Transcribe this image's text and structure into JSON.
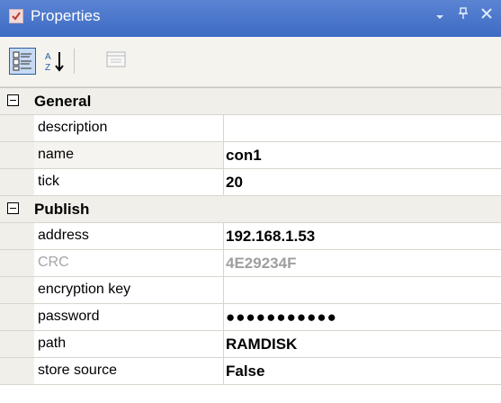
{
  "window": {
    "title": "Properties",
    "icon": "properties-icon",
    "controls": [
      "dropdown-icon",
      "pin-icon",
      "close-icon"
    ]
  },
  "toolbar": {
    "buttons": [
      {
        "name": "categorized-icon",
        "active": true
      },
      {
        "name": "alphabetical-sort-icon",
        "active": false
      },
      {
        "name": "property-pages-icon",
        "active": false,
        "disabled": true
      }
    ]
  },
  "grid": {
    "categories": [
      {
        "label": "General",
        "expanded": true,
        "properties": [
          {
            "name": "description",
            "value": ""
          },
          {
            "name": "name",
            "value": "con1"
          },
          {
            "name": "tick",
            "value": "20"
          }
        ]
      },
      {
        "label": "Publish",
        "expanded": true,
        "properties": [
          {
            "name": "address",
            "value": "192.168.1.53"
          },
          {
            "name": "CRC",
            "value": "4E29234F",
            "readonly": true
          },
          {
            "name": "encryption key",
            "value": ""
          },
          {
            "name": "password",
            "value": "●●●●●●●●●●●"
          },
          {
            "name": "path",
            "value": "RAMDISK"
          },
          {
            "name": "store source",
            "value": "False"
          }
        ]
      }
    ]
  },
  "colors": {
    "titlebar": "#3d6bc3",
    "toolbar": "#f4f3ee",
    "gutter": "#f0efea",
    "readonly_text": "#a5a5a5"
  }
}
